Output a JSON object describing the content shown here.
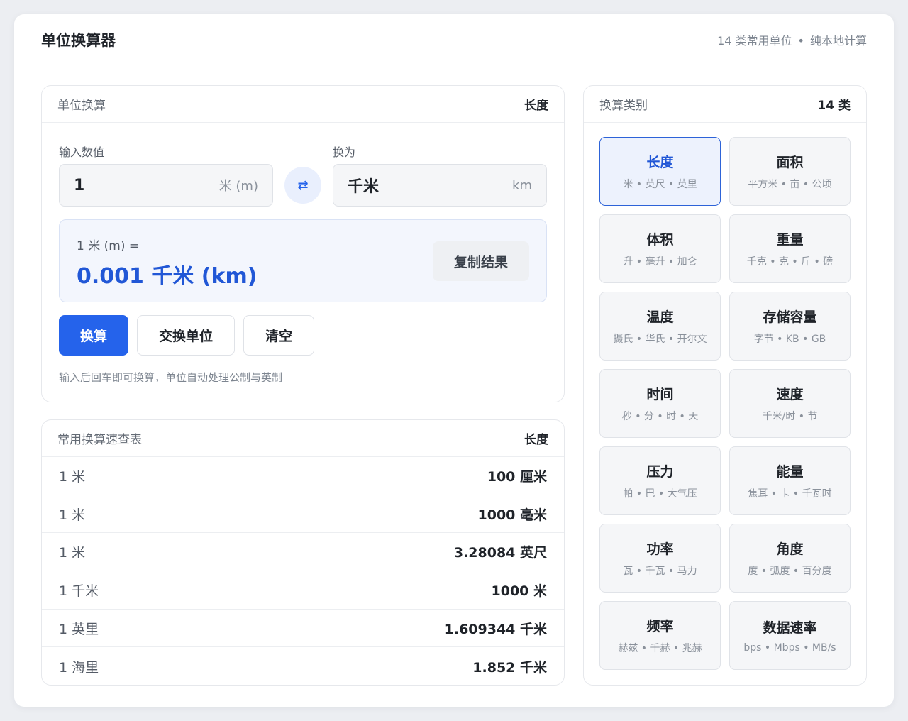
{
  "header": {
    "title": "单位换算器",
    "subtitle_count": "14 类常用单位",
    "subtitle_dot": "•",
    "subtitle_note": "纯本地计算"
  },
  "converter": {
    "card_label": "单位换算",
    "card_meta": "长度",
    "input_label": "输入数值",
    "input_value": "1",
    "input_unit": "米 (m)",
    "swap_icon": "⇄",
    "target_label": "换为",
    "target_value": "千米",
    "target_unit": "km",
    "result_equation": "1 米 (m) =",
    "result_value": "0.001 千米 (km)",
    "copy_label": "复制结果",
    "convert_label": "换算",
    "swap_label": "交换单位",
    "clear_label": "清空",
    "hint": "输入后回车即可换算，单位自动处理公制与英制"
  },
  "quick_table": {
    "card_label": "常用换算速查表",
    "card_meta": "长度",
    "rows": [
      {
        "from": "1 米",
        "to": "100 厘米"
      },
      {
        "from": "1 米",
        "to": "1000 毫米"
      },
      {
        "from": "1 米",
        "to": "3.28084 英尺"
      },
      {
        "from": "1 千米",
        "to": "1000 米"
      },
      {
        "from": "1 英里",
        "to": "1.609344 千米"
      },
      {
        "from": "1 海里",
        "to": "1.852 千米"
      }
    ]
  },
  "categories": {
    "card_label": "换算类别",
    "card_meta": "14 类",
    "items": [
      {
        "name": "长度",
        "units": "米 • 英尺 • 英里",
        "active": true
      },
      {
        "name": "面积",
        "units": "平方米 • 亩 • 公顷"
      },
      {
        "name": "体积",
        "units": "升 • 毫升 • 加仑"
      },
      {
        "name": "重量",
        "units": "千克 • 克 • 斤 • 磅"
      },
      {
        "name": "温度",
        "units": "摄氏 • 华氏 • 开尔文"
      },
      {
        "name": "存储容量",
        "units": "字节 • KB • GB"
      },
      {
        "name": "时间",
        "units": "秒 • 分 • 时 • 天"
      },
      {
        "name": "速度",
        "units": "千米/时 • 节"
      },
      {
        "name": "压力",
        "units": "帕 • 巴 • 大气压"
      },
      {
        "name": "能量",
        "units": "焦耳 • 卡 • 千瓦时"
      },
      {
        "name": "功率",
        "units": "瓦 • 千瓦 • 马力"
      },
      {
        "name": "角度",
        "units": "度 • 弧度 • 百分度"
      },
      {
        "name": "频率",
        "units": "赫兹 • 千赫 • 兆赫"
      },
      {
        "name": "数据速率",
        "units": "bps • Mbps • MB/s"
      }
    ]
  }
}
